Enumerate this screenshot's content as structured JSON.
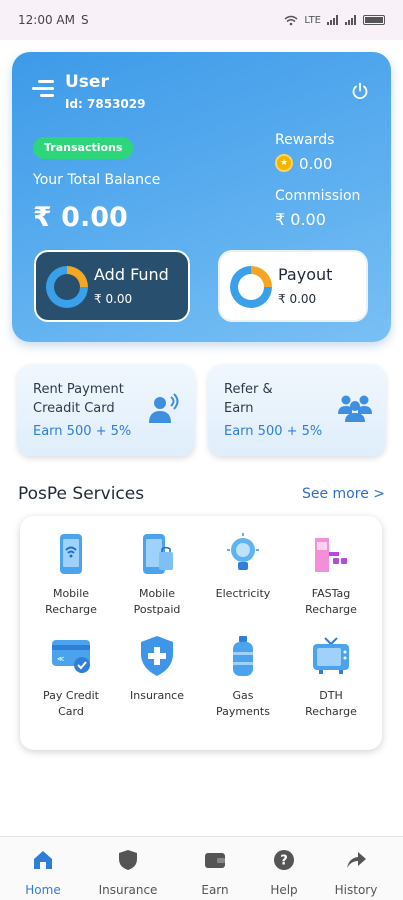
{
  "status_bar": {
    "time": "12:00 AM",
    "sim_glyph": "S",
    "network": "LTE"
  },
  "wallet": {
    "user_name": "User",
    "user_id": "Id: 7853029",
    "transactions_pill": "Transactions",
    "total_balance_label": "Your Total Balance",
    "total_balance_value": "₹ 0.00",
    "rewards_label": "Rewards",
    "rewards_value": "0.00",
    "commission_label": "Commission",
    "commission_value": "₹ 0.00",
    "add_fund": {
      "label": "Add Fund",
      "value": "₹ 0.00"
    },
    "payout": {
      "label": "Payout",
      "value": "₹ 0.00"
    }
  },
  "promos": [
    {
      "title_line1": "Rent Payment",
      "title_line2": "Creadit Card",
      "earn": "Earn 500 + 5%"
    },
    {
      "title_line1": "Refer &",
      "title_line2": "Earn",
      "earn": "Earn 500 + 5%"
    }
  ],
  "services": {
    "title": "PosPe Services",
    "see_more": "See more >",
    "items": [
      {
        "line1": "Mobile",
        "line2": "Recharge",
        "icon": "mobile-recharge-icon"
      },
      {
        "line1": "Mobile",
        "line2": "Postpaid",
        "icon": "mobile-postpaid-icon"
      },
      {
        "line1": "Electricity",
        "line2": "",
        "icon": "bulb-icon"
      },
      {
        "line1": "FASTag",
        "line2": "Recharge",
        "icon": "fastag-icon"
      },
      {
        "line1": "Pay Credit",
        "line2": "Card",
        "icon": "credit-card-icon"
      },
      {
        "line1": "Insurance",
        "line2": "",
        "icon": "shield-plus-icon"
      },
      {
        "line1": "Gas",
        "line2": "Payments",
        "icon": "gas-cylinder-icon"
      },
      {
        "line1": "DTH",
        "line2": "Recharge",
        "icon": "tv-icon"
      }
    ]
  },
  "bottom_nav": [
    {
      "label": "Home",
      "icon": "home-icon",
      "active": true
    },
    {
      "label": "Insurance",
      "icon": "shield-icon",
      "active": false
    },
    {
      "label": "Earn",
      "icon": "wallet-icon",
      "active": false
    },
    {
      "label": "Help",
      "icon": "help-icon",
      "active": false
    },
    {
      "label": "History",
      "icon": "share-arrow-icon",
      "active": false
    }
  ],
  "colors": {
    "accent": "#2f7fd8",
    "wallet_gradient_start": "#3d9ae8",
    "success": "#2ed67a",
    "dark_button": "#28506e"
  }
}
